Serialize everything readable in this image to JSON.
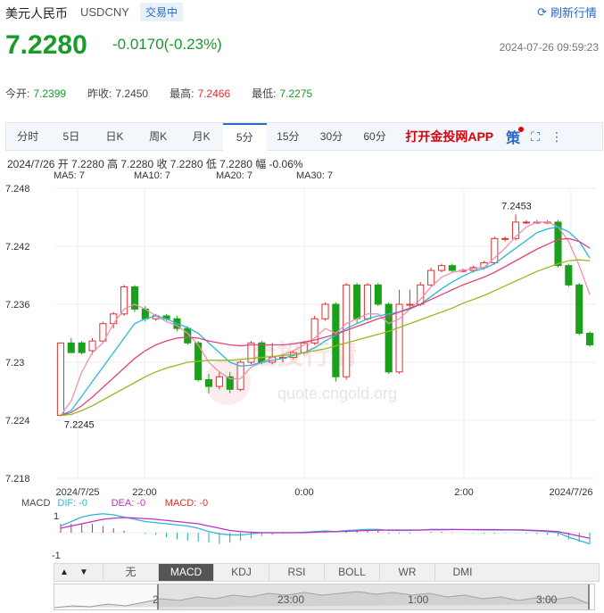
{
  "header": {
    "title": "美元人民币",
    "code": "USDCNY",
    "status_badge": "交易中",
    "refresh_label": "刷新行情",
    "price": "7.2280",
    "change": "-0.0170(-0.23%)",
    "timestamp": "2024-07-26 09:59:23"
  },
  "stats": {
    "open_label": "今开:",
    "open": "7.2399",
    "prev_label": "昨收:",
    "prev": "7.2450",
    "high_label": "最高:",
    "high": "7.2466",
    "low_label": "最低:",
    "low": "7.2275"
  },
  "tabs": [
    "分时",
    "5日",
    "日K",
    "周K",
    "月K",
    "5分",
    "15分",
    "30分",
    "60分"
  ],
  "active_tab": "5分",
  "app_link": "打开金投网APP",
  "ce_label": "策",
  "info_line": "2024/7/26  开 7.2280  高 7.2280  收 7.2280  低 7.2280  幅 -0.06%",
  "ma_labels": [
    {
      "text": "MA5: 7",
      "color": "#f090b0"
    },
    {
      "text": "MA10: 7",
      "color": "#2ab8d8"
    },
    {
      "text": "MA20: 7",
      "color": "#e0447a"
    },
    {
      "text": "MA30: 7",
      "color": "#9ab820"
    }
  ],
  "watermark": {
    "text": "金投行情",
    "url": "quote.cngold.org"
  },
  "colors": {
    "up": "#e03030",
    "down": "#1aa01a",
    "grid": "#eeeeee"
  },
  "chart_data": {
    "type": "candlestick",
    "ylim": [
      7.218,
      7.248
    ],
    "y_ticks": [
      "7.248",
      "7.242",
      "7.236",
      "7.23",
      "7.224",
      "7.218"
    ],
    "x_ticks": [
      "2024/7/25",
      "22:00",
      "0:00",
      "2:00",
      "2024/7/26"
    ],
    "annotations": [
      {
        "text": "7.2453",
        "x_index": 42,
        "y": 7.2453
      },
      {
        "text": "7.2245",
        "x_index": 0,
        "y": 7.2245
      }
    ],
    "candles": [
      [
        7.2245,
        7.232,
        7.225,
        7.232
      ],
      [
        7.232,
        7.231,
        7.231,
        7.2325
      ],
      [
        7.232,
        7.231,
        7.2308,
        7.2322
      ],
      [
        7.2312,
        7.2322,
        7.2308,
        7.2325
      ],
      [
        7.2322,
        7.234,
        7.232,
        7.2342
      ],
      [
        7.234,
        7.235,
        7.2335,
        7.2352
      ],
      [
        7.235,
        7.2378,
        7.2348,
        7.238
      ],
      [
        7.2378,
        7.2355,
        7.2352,
        7.238
      ],
      [
        7.2355,
        7.2345,
        7.2342,
        7.2358
      ],
      [
        7.2345,
        7.2348,
        7.2343,
        7.235
      ],
      [
        7.2348,
        7.2345,
        7.2343,
        7.235
      ],
      [
        7.2345,
        7.2335,
        7.2332,
        7.2348
      ],
      [
        7.2335,
        7.232,
        7.2318,
        7.2337
      ],
      [
        7.232,
        7.2282,
        7.228,
        7.2322
      ],
      [
        7.2282,
        7.2275,
        7.2268,
        7.2288
      ],
      [
        7.2275,
        7.2285,
        7.2272,
        7.229
      ],
      [
        7.2285,
        7.2272,
        7.2268,
        7.229
      ],
      [
        7.2272,
        7.23,
        7.227,
        7.2302
      ],
      [
        7.23,
        7.232,
        7.2298,
        7.2322
      ],
      [
        7.232,
        7.23,
        7.2298,
        7.2322
      ],
      [
        7.23,
        7.2305,
        7.2298,
        7.232
      ],
      [
        7.2305,
        7.2305,
        7.23,
        7.2308
      ],
      [
        7.2305,
        7.231,
        7.2303,
        7.2312
      ],
      [
        7.231,
        7.232,
        7.2308,
        7.2322
      ],
      [
        7.232,
        7.2345,
        7.2318,
        7.2348
      ],
      [
        7.2345,
        7.236,
        7.2343,
        7.2362
      ],
      [
        7.236,
        7.2285,
        7.228,
        7.2362
      ],
      [
        7.2285,
        7.238,
        7.2282,
        7.2382
      ],
      [
        7.238,
        7.2345,
        7.234,
        7.2382
      ],
      [
        7.2345,
        7.238,
        7.2343,
        7.2382
      ],
      [
        7.238,
        7.236,
        7.2358,
        7.2382
      ],
      [
        7.236,
        7.229,
        7.2288,
        7.2362
      ],
      [
        7.229,
        7.236,
        7.2288,
        7.2375
      ],
      [
        7.236,
        7.236,
        7.2355,
        7.2375
      ],
      [
        7.236,
        7.238,
        7.2358,
        7.2383
      ],
      [
        7.238,
        7.2395,
        7.2378,
        7.2398
      ],
      [
        7.2395,
        7.24,
        7.2393,
        7.2402
      ],
      [
        7.24,
        7.2395,
        7.2393,
        7.2402
      ],
      [
        7.2395,
        7.2395,
        7.2393,
        7.2397
      ],
      [
        7.2395,
        7.2398,
        7.2393,
        7.24
      ],
      [
        7.2398,
        7.2403,
        7.2396,
        7.2405
      ],
      [
        7.2403,
        7.2428,
        7.2401,
        7.243
      ],
      [
        7.2428,
        7.2428,
        7.2425,
        7.243
      ],
      [
        7.2428,
        7.2445,
        7.2426,
        7.2453
      ],
      [
        7.2445,
        7.2445,
        7.2443,
        7.2447
      ],
      [
        7.2445,
        7.2445,
        7.2443,
        7.2447
      ],
      [
        7.2445,
        7.2445,
        7.2443,
        7.2447
      ],
      [
        7.2445,
        7.24,
        7.2398,
        7.2447
      ],
      [
        7.24,
        7.238,
        7.2378,
        7.2402
      ],
      [
        7.238,
        7.233,
        7.2328,
        7.2382
      ],
      [
        7.233,
        7.2318,
        7.2316,
        7.2332
      ]
    ],
    "ma_series": [
      {
        "name": "MA5",
        "color": "#f090b0",
        "values": [
          7.2245,
          7.226,
          7.229,
          7.231,
          7.232,
          7.234,
          7.2355,
          7.236,
          7.2355,
          7.2348,
          7.2342,
          7.2338,
          7.233,
          7.2318,
          7.23,
          7.229,
          7.2283,
          7.2283,
          7.2295,
          7.23,
          7.2305,
          7.2308,
          7.2312,
          7.2318,
          7.2325,
          7.2335,
          7.233,
          7.234,
          7.2345,
          7.235,
          7.235,
          7.234,
          7.2345,
          7.2355,
          7.2365,
          7.2378,
          7.2388,
          7.2393,
          7.2395,
          7.2397,
          7.2398,
          7.2408,
          7.2418,
          7.243,
          7.244,
          7.2445,
          7.2445,
          7.244,
          7.2425,
          7.24,
          7.237
        ]
      },
      {
        "name": "MA10",
        "color": "#2ab8d8",
        "values": [
          7.2245,
          7.225,
          7.2265,
          7.228,
          7.2295,
          7.231,
          7.2325,
          7.234,
          7.2345,
          7.2348,
          7.2345,
          7.234,
          7.2336,
          7.233,
          7.232,
          7.231,
          7.23,
          7.2296,
          7.2297,
          7.23,
          7.2302,
          7.2304,
          7.2307,
          7.231,
          7.2315,
          7.2322,
          7.2328,
          7.2335,
          7.234,
          7.2345,
          7.2348,
          7.235,
          7.2352,
          7.2355,
          7.236,
          7.2368,
          7.2376,
          7.2383,
          7.2389,
          7.2394,
          7.2397,
          7.2402,
          7.241,
          7.2418,
          7.2426,
          7.2434,
          7.2438,
          7.244,
          7.2435,
          7.2425,
          7.2408
        ]
      },
      {
        "name": "MA20",
        "color": "#e0447a",
        "values": [
          7.2245,
          7.2248,
          7.2255,
          7.2264,
          7.2274,
          7.2284,
          7.2294,
          7.2304,
          7.2312,
          7.2318,
          7.2322,
          7.2325,
          7.2326,
          7.2325,
          7.2322,
          7.232,
          7.2318,
          7.2317,
          7.2318,
          7.2318,
          7.2318,
          7.2318,
          7.2319,
          7.2321,
          7.2323,
          7.2326,
          7.2329,
          7.2333,
          7.2337,
          7.2341,
          7.2345,
          7.2348,
          7.2352,
          7.2356,
          7.236,
          7.2365,
          7.237,
          7.2375,
          7.238,
          7.2384,
          7.2388,
          7.2393,
          7.2399,
          7.2405,
          7.2411,
          7.2417,
          7.2422,
          7.2427,
          7.2428,
          7.2425,
          7.2418
        ]
      },
      {
        "name": "MA30",
        "color": "#9ab820",
        "values": [
          7.2245,
          7.2246,
          7.225,
          7.2255,
          7.2261,
          7.2267,
          7.2273,
          7.2279,
          7.2285,
          7.229,
          7.2294,
          7.2297,
          7.23,
          7.2301,
          7.2302,
          7.2302,
          7.2302,
          7.2303,
          7.2304,
          7.2305,
          7.2306,
          7.2307,
          7.2308,
          7.231,
          7.2312,
          7.2314,
          7.2317,
          7.232,
          7.2323,
          7.2326,
          7.2329,
          7.2332,
          7.2336,
          7.234,
          7.2344,
          7.2348,
          7.2352,
          7.2356,
          7.2361,
          7.2365,
          7.2369,
          7.2374,
          7.2379,
          7.2384,
          7.2389,
          7.2394,
          7.2398,
          7.2402,
          7.2405,
          7.2406,
          7.2405
        ]
      }
    ],
    "macd": {
      "labels": [
        {
          "text": "MACD",
          "color": "#444"
        },
        {
          "text": "DIF: -0",
          "color": "#2ab8d8"
        },
        {
          "text": "DEA: -0",
          "color": "#c030c0"
        },
        {
          "text": "MACD: -0",
          "color": "#e03030"
        }
      ],
      "ylim": [
        -1,
        1
      ],
      "dif": [
        0.3,
        0.5,
        0.7,
        0.8,
        0.85,
        0.8,
        0.7,
        0.6,
        0.5,
        0.45,
        0.4,
        0.35,
        0.3,
        0.2,
        0.05,
        -0.05,
        -0.1,
        -0.1,
        -0.05,
        0.0,
        0.0,
        0.0,
        0.0,
        0.02,
        0.05,
        0.08,
        0.05,
        0.1,
        0.12,
        0.15,
        0.15,
        0.1,
        0.1,
        0.1,
        0.12,
        0.15,
        0.15,
        0.15,
        0.14,
        0.13,
        0.12,
        0.12,
        0.12,
        0.12,
        0.1,
        0.08,
        0.05,
        0.0,
        -0.2,
        -0.35,
        -0.5
      ],
      "dea": [
        0.2,
        0.3,
        0.4,
        0.5,
        0.6,
        0.65,
        0.68,
        0.66,
        0.63,
        0.6,
        0.55,
        0.5,
        0.45,
        0.4,
        0.3,
        0.2,
        0.1,
        0.05,
        0.02,
        0.0,
        0.0,
        0.0,
        0.0,
        0.0,
        0.02,
        0.04,
        0.05,
        0.06,
        0.08,
        0.1,
        0.11,
        0.12,
        0.12,
        0.12,
        0.12,
        0.13,
        0.13,
        0.14,
        0.14,
        0.14,
        0.14,
        0.14,
        0.13,
        0.13,
        0.12,
        0.1,
        0.08,
        0.05,
        -0.05,
        -0.15,
        -0.25
      ],
      "hist": [
        0.4,
        0.4,
        0.4,
        0.4,
        0.3,
        0.2,
        0.1,
        0.0,
        -0.05,
        -0.1,
        -0.2,
        -0.3,
        -0.35,
        -0.4,
        -0.45,
        -0.5,
        -0.45,
        -0.35,
        -0.25,
        -0.15,
        -0.1,
        -0.05,
        0.0,
        0.02,
        0.05,
        0.08,
        0.0,
        0.08,
        0.08,
        0.1,
        0.08,
        -0.05,
        -0.04,
        -0.04,
        0.0,
        0.04,
        0.04,
        0.02,
        0.0,
        -0.02,
        -0.04,
        -0.04,
        -0.02,
        -0.02,
        -0.04,
        -0.06,
        -0.1,
        -0.15,
        -0.3,
        -0.4,
        -0.5
      ]
    }
  },
  "bottom_tabs": [
    "无",
    "MACD",
    "KDJ",
    "RSI",
    "BOLL",
    "WR",
    "DMI"
  ],
  "active_bottom_tab": "MACD",
  "navigator_labels": [
    "2",
    "23:00",
    "1:00",
    "3:00"
  ]
}
